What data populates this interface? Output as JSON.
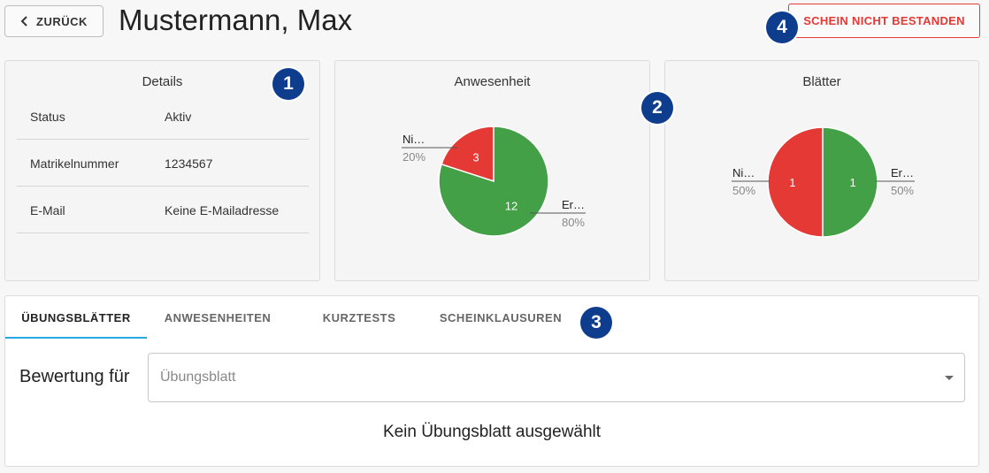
{
  "header": {
    "back_label": "ZURÜCK",
    "title": "Mustermann, Max",
    "fail_label": "SCHEIN NICHT BESTANDEN"
  },
  "badges": [
    "1",
    "2",
    "3",
    "4"
  ],
  "details": {
    "title": "Details",
    "rows": [
      {
        "label": "Status",
        "value": "Aktiv"
      },
      {
        "label": "Matrikelnummer",
        "value": "1234567"
      },
      {
        "label": "E-Mail",
        "value": "Keine E-Mailadresse"
      }
    ]
  },
  "chart_data": [
    {
      "type": "pie",
      "title": "Anwesenheit",
      "slices": [
        {
          "label": "Ni…",
          "value": 3,
          "percent_label": "20%",
          "color": "#e53935"
        },
        {
          "label": "Er…",
          "value": 12,
          "percent_label": "80%",
          "color": "#43a047"
        }
      ]
    },
    {
      "type": "pie",
      "title": "Blätter",
      "slices": [
        {
          "label": "Ni…",
          "value": 1,
          "percent_label": "50%",
          "color": "#e53935"
        },
        {
          "label": "Er…",
          "value": 1,
          "percent_label": "50%",
          "color": "#43a047"
        }
      ]
    }
  ],
  "tabs": [
    {
      "label": "ÜBUNGSBLÄTTER",
      "active": true
    },
    {
      "label": "ANWESENHEITEN",
      "active": false
    },
    {
      "label": "KURZTESTS",
      "active": false
    },
    {
      "label": "SCHEINKLAUSUREN",
      "active": false
    }
  ],
  "bewertung": {
    "label": "Bewertung für",
    "placeholder": "Übungsblatt",
    "empty_message": "Kein Übungsblatt ausgewählt"
  },
  "colors": {
    "accent": "#29a8e0",
    "badge": "#0d3d8c",
    "danger": "#e53935",
    "success": "#43a047"
  }
}
